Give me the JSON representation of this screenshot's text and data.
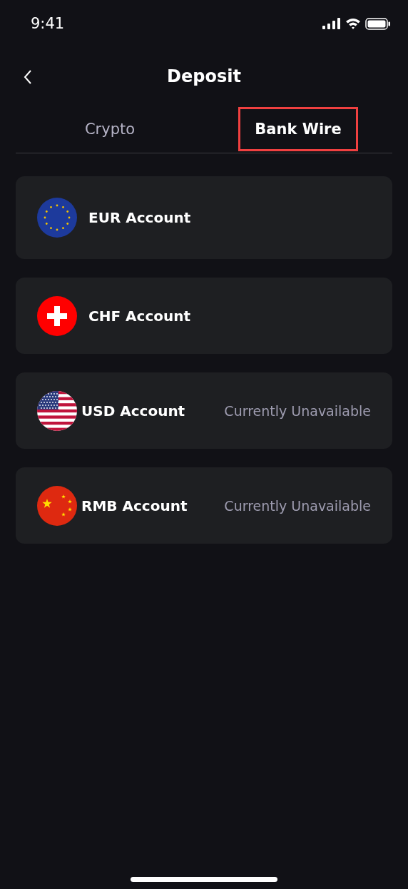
{
  "status_bar": {
    "time": "9:41"
  },
  "header": {
    "title": "Deposit"
  },
  "tabs": [
    {
      "label": "Crypto",
      "selected": false,
      "highlighted": false
    },
    {
      "label": "Bank Wire",
      "selected": true,
      "highlighted": true
    }
  ],
  "accounts": [
    {
      "kind": "eu",
      "name": "EUR Account",
      "available": true
    },
    {
      "kind": "ch",
      "name": "CHF Account",
      "available": true
    },
    {
      "kind": "us",
      "name": "USD Account",
      "available": false,
      "status": "Currently Unavailable"
    },
    {
      "kind": "cn",
      "name": "RMB Account",
      "available": false,
      "status": "Currently Unavailable"
    }
  ]
}
